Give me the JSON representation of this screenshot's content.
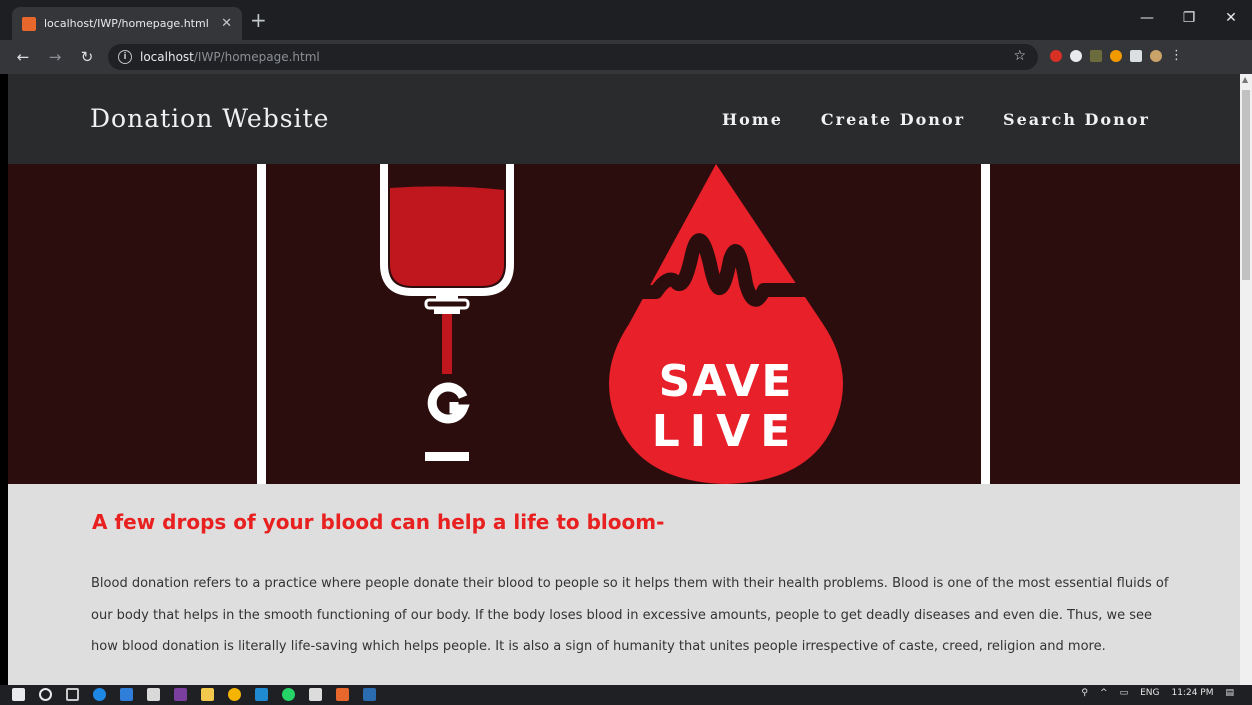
{
  "browser": {
    "tab_title": "localhost/IWP/homepage.html",
    "tab_close": "✕",
    "new_tab": "+",
    "url_host": "localhost",
    "url_path": "/IWP/homepage.html",
    "window_controls": {
      "minimize": "—",
      "maximize": "❐",
      "close": "✕"
    }
  },
  "site": {
    "brand": "Donation Website",
    "menu": [
      "Home",
      "Create Donor",
      "Search Donor"
    ]
  },
  "hero": {
    "text_line1": "SAVE",
    "text_line2": "LIVE",
    "colors": {
      "background": "#2c0d0d",
      "blood": "#e8202a",
      "line": "#ffffff"
    }
  },
  "content": {
    "headline": "A few drops of your blood can help a life to bloom-",
    "paragraph": "Blood donation refers to a practice where people donate their blood to people so it helps them with their health problems. Blood is one of the most essential fluids of our body that helps in the smooth functioning of our body. If the body loses blood in excessive amounts, people to get deadly diseases and even die. Thus, we see how blood donation is literally life-saving which helps people. It is also a sign of humanity that unites people irrespective of caste, creed, religion and more."
  },
  "taskbar": {
    "language": "ENG",
    "time": "11:24 PM"
  }
}
